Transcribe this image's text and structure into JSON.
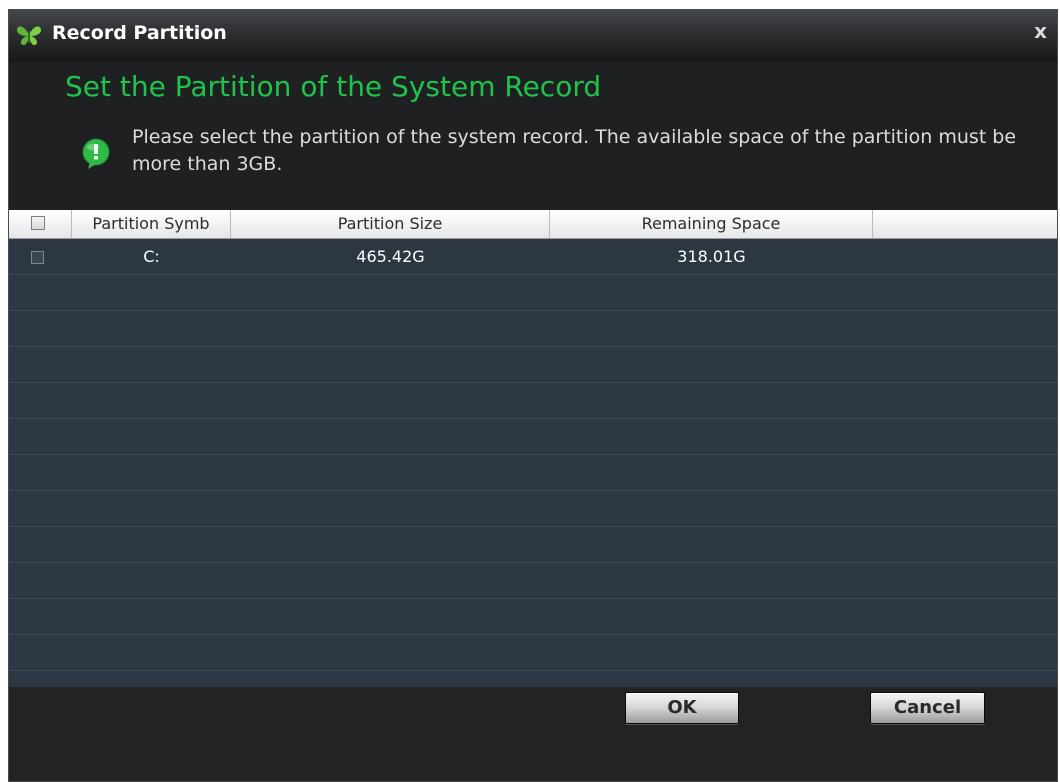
{
  "window": {
    "title": "Record Partition",
    "close_symbol": "x",
    "app_icon": "butterfly-icon"
  },
  "header": {
    "heading": "Set the Partition of the System Record",
    "info_icon": "info-bubble-icon",
    "message": "Please select the partition of the system record. The available space of the partition must be more than 3GB."
  },
  "table": {
    "columns": [
      "Partition Symb",
      "Partition Size",
      "Remaining Space"
    ],
    "rows": [
      {
        "symbol": "C:",
        "size": "465.42G",
        "remaining": "318.01G",
        "checked": false
      }
    ]
  },
  "buttons": {
    "ok_label": "OK",
    "cancel_label": "Cancel"
  },
  "colors": {
    "accent_green": "#1fc24a",
    "table_bg": "#2d3744",
    "window_bg": "#232527"
  }
}
